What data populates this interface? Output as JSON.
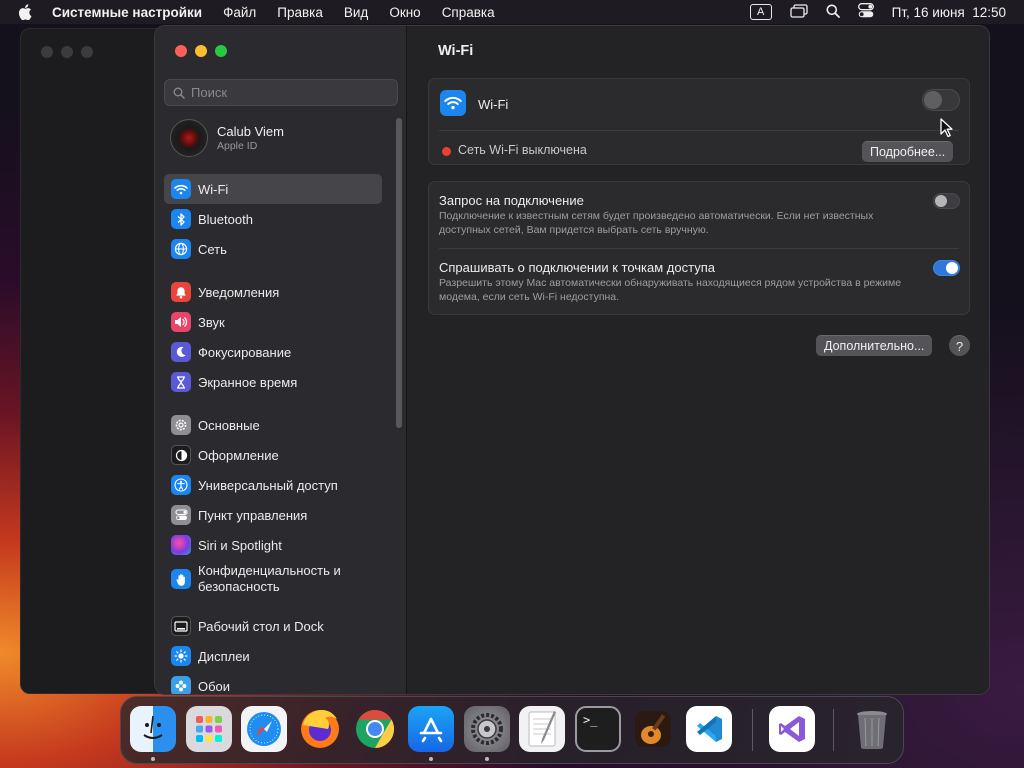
{
  "menubar": {
    "app_name": "Системные настройки",
    "menus": [
      "Файл",
      "Правка",
      "Вид",
      "Окно",
      "Справка"
    ],
    "input_indicator": "A",
    "datetime": "Пт, 16 июня  12:50"
  },
  "sidebar": {
    "search_placeholder": "Поиск",
    "user": {
      "name": "Calub Viem",
      "subtitle": "Apple ID"
    },
    "groups": [
      [
        {
          "label": "Wi-Fi",
          "icon": "wifi-icon",
          "color": "#1b86f0",
          "active": true
        },
        {
          "label": "Bluetooth",
          "icon": "bluetooth-icon",
          "color": "#1b86f0"
        },
        {
          "label": "Сеть",
          "icon": "globe-icon",
          "color": "#1b86f0"
        }
      ],
      [
        {
          "label": "Уведомления",
          "icon": "bell-icon",
          "color": "#e8453c"
        },
        {
          "label": "Звук",
          "icon": "speaker-icon",
          "color": "#e8456a"
        },
        {
          "label": "Фокусирование",
          "icon": "moon-icon",
          "color": "#5b5ad6"
        },
        {
          "label": "Экранное время",
          "icon": "hourglass-icon",
          "color": "#5b5ad6"
        }
      ],
      [
        {
          "label": "Основные",
          "icon": "gear-icon",
          "color": "#8e8e93"
        },
        {
          "label": "Оформление",
          "icon": "appearance-icon",
          "color": "#1c1c1e"
        },
        {
          "label": "Универсальный доступ",
          "icon": "accessibility-icon",
          "color": "#1b86f0"
        },
        {
          "label": "Пункт управления",
          "icon": "control-center-icon",
          "color": "#8e8e93"
        },
        {
          "label": "Siri и Spotlight",
          "icon": "siri-icon",
          "color": "#9b4bd8"
        },
        {
          "label": "Конфиденциальность и безопасность",
          "line1": "Конфиденциальность и",
          "line2": "безопасность",
          "icon": "hand-icon",
          "color": "#1b86f0"
        }
      ],
      [
        {
          "label": "Рабочий стол и Dock",
          "icon": "desktop-dock-icon",
          "color": "#1c1c1e"
        },
        {
          "label": "Дисплеи",
          "icon": "sun-icon",
          "color": "#1b86f0"
        },
        {
          "label": "Обои",
          "icon": "wallpaper-icon",
          "color": "#3aa0e8"
        }
      ]
    ]
  },
  "main": {
    "title": "Wi-Fi",
    "wifi": {
      "label": "Wi-Fi",
      "enabled": false,
      "status_text": "Сеть Wi-Fi выключена",
      "status_color": "#e8432e",
      "details_button": "Подробнее..."
    },
    "options": [
      {
        "title": "Запрос на подключение",
        "description": "Подключение к известным сетям будет произведено автоматически. Если нет известных доступных сетей, Вам придется выбрать сеть вручную.",
        "enabled": false
      },
      {
        "title": "Спрашивать о подключении к точкам доступа",
        "description": "Разрешить этому Mac автоматически обнаруживать находящиеся рядом устройства в режиме модема, если сеть Wi-Fi недоступна.",
        "enabled": true
      }
    ],
    "advanced_button": "Дополнительно...",
    "help_button": "?"
  },
  "dock": {
    "apps": [
      {
        "name": "Finder",
        "icon": "finder-icon",
        "running": true
      },
      {
        "name": "Launchpad",
        "icon": "launchpad-icon",
        "running": false
      },
      {
        "name": "Safari",
        "icon": "safari-icon",
        "running": false
      },
      {
        "name": "Firefox",
        "icon": "firefox-icon",
        "running": false
      },
      {
        "name": "Google Chrome",
        "icon": "chrome-icon",
        "running": false
      },
      {
        "name": "App Store",
        "icon": "app-store-icon",
        "running": true
      },
      {
        "name": "Системные настройки",
        "icon": "system-settings-icon",
        "running": true
      },
      {
        "name": "TextEdit",
        "icon": "textedit-icon",
        "running": false
      },
      {
        "name": "Терминал",
        "icon": "terminal-icon",
        "running": false
      },
      {
        "name": "GarageBand",
        "icon": "garageband-icon",
        "running": false
      },
      {
        "name": "Visual Studio Code",
        "icon": "vscode-icon",
        "running": false
      },
      {
        "name": "Visual Studio",
        "icon": "visual-studio-icon",
        "running": false
      },
      {
        "name": "Корзина",
        "icon": "trash-icon",
        "running": false
      }
    ]
  }
}
